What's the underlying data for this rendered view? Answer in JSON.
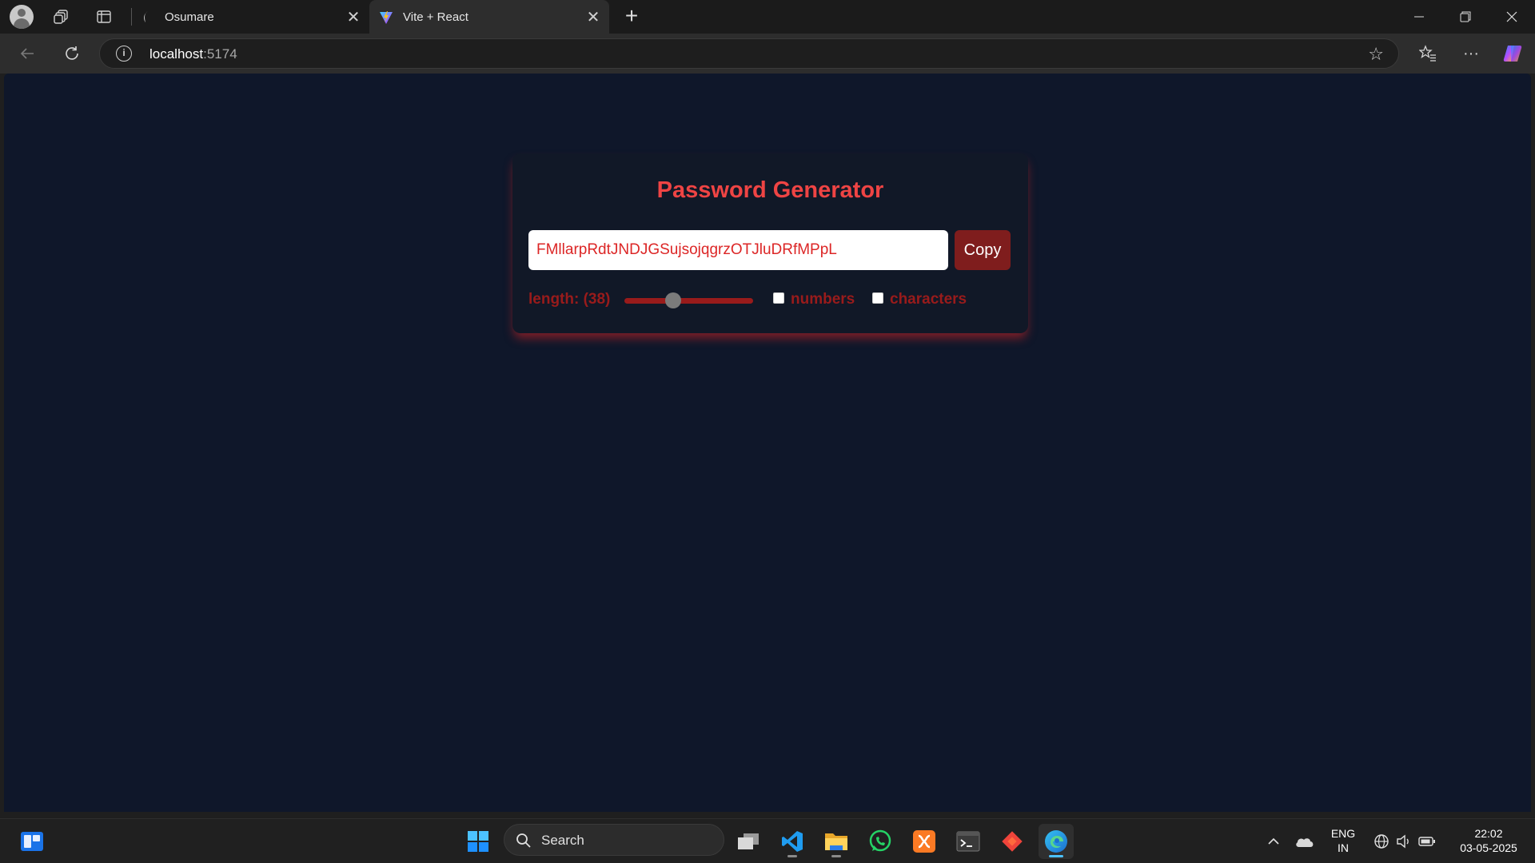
{
  "browser": {
    "tabs": [
      {
        "title": "Osumare",
        "active": false
      },
      {
        "title": "Vite + React",
        "active": true
      }
    ],
    "address": {
      "host": "localhost",
      "port": ":5174"
    }
  },
  "app": {
    "title": "Password Generator",
    "password": "FMllarpRdtJNDJGSujsojqgrzOTJluDRfMPpL",
    "copy_label": "Copy",
    "length_label": "length: (38)",
    "length_value": 38,
    "slider_fraction": 0.38,
    "numbers_label": "numbers",
    "numbers_checked": false,
    "characters_label": "characters",
    "characters_checked": false
  },
  "taskbar": {
    "search_label": "Search",
    "language": "ENG",
    "region": "IN",
    "time": "22:02",
    "date": "03-05-2025"
  },
  "colors": {
    "page_bg": "#0f172a",
    "card_bg": "#111827",
    "accent_red": "#ef4444",
    "label_red": "#991b1b",
    "button_red": "#7f1d1d"
  }
}
